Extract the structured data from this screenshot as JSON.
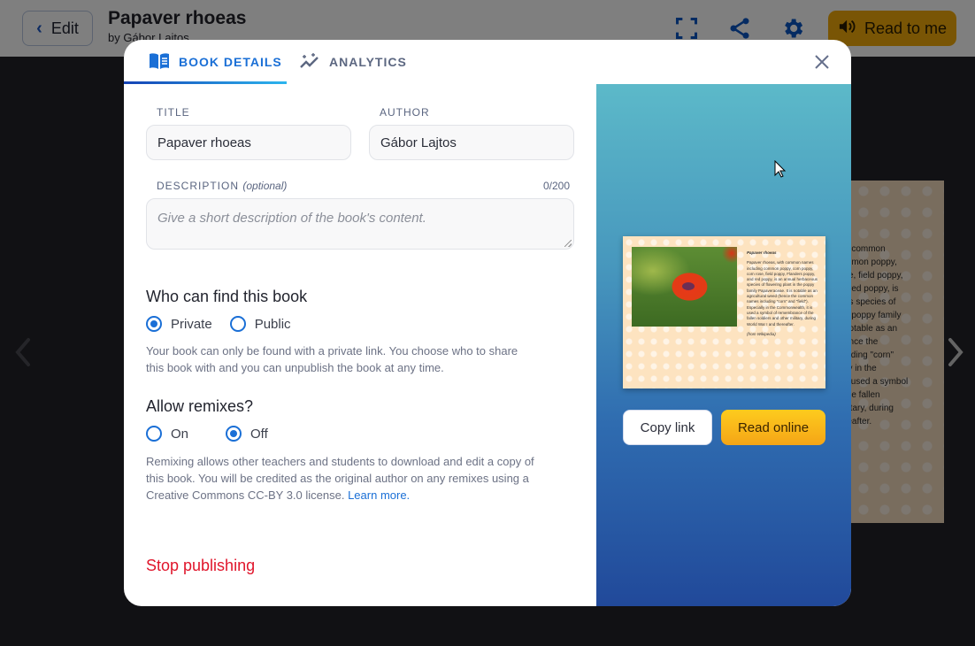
{
  "header": {
    "edit_label": "Edit",
    "book_title": "Papaver rhoeas",
    "book_author": "by Gábor Lajtos",
    "read_to_me_label": "Read to me",
    "icons": [
      "fullscreen-icon",
      "share-icon",
      "settings-icon",
      "speaker-icon"
    ]
  },
  "background_page": {
    "text_fragment": "h common\nmmon poppy,\nse, field poppy,\nl red poppy, is\nus species of\ne poppy family\nnotable as an\nence the\nluding \"corn\"\nlly in the\ns used a symbol\nthe fallen\nilitary, during\nreafter."
  },
  "modal": {
    "tabs": [
      {
        "label": "BOOK DETAILS",
        "icon": "book-icon",
        "active": true
      },
      {
        "label": "ANALYTICS",
        "icon": "analytics-icon",
        "active": false
      }
    ],
    "form": {
      "title_label": "TITLE",
      "title_value": "Papaver rhoeas",
      "author_label": "AUTHOR",
      "author_value": "Gábor Lajtos",
      "description_label": "DESCRIPTION",
      "description_optional": "(optional)",
      "description_counter": "0/200",
      "description_value": "",
      "description_placeholder": "Give a short description of the book's content."
    },
    "visibility": {
      "heading": "Who can find this book",
      "options": [
        {
          "label": "Private",
          "selected": true
        },
        {
          "label": "Public",
          "selected": false
        }
      ],
      "help_text": "Your book can only be found with a private link. You choose who to share this book with and you can unpublish the book at any time."
    },
    "remixes": {
      "heading": "Allow remixes?",
      "options": [
        {
          "label": "On",
          "selected": false
        },
        {
          "label": "Off",
          "selected": true
        }
      ],
      "help_text": "Remixing allows other teachers and students to download and edit a copy of this book. You will be credited as the original author on any remixes using a Creative Commons CC-BY 3.0 license.",
      "learn_more_label": "Learn more."
    },
    "stop_publishing_label": "Stop publishing",
    "preview": {
      "page_title": "Papaver rhoeas",
      "page_text": "Papaver rhoeas, with common names including common poppy, corn poppy, corn rose, field poppy, Flanders poppy, and red poppy, is an annual herbaceous species of flowering plant in the poppy family Papaveraceae. It is notable as an agricultural weed (hence the common names including \"corn\" and \"field\"). Especially in the Commonwealth, it is used a symbol of remembrance of the fallen soldiers and other military, during World War I and thereafter.",
      "page_source": "(from Wikipedia)",
      "copy_link_label": "Copy link",
      "read_online_label": "Read online"
    }
  },
  "colors": {
    "accent": "#1a6fd6",
    "danger": "#e0152b",
    "read_button": "#f3aa0a"
  }
}
